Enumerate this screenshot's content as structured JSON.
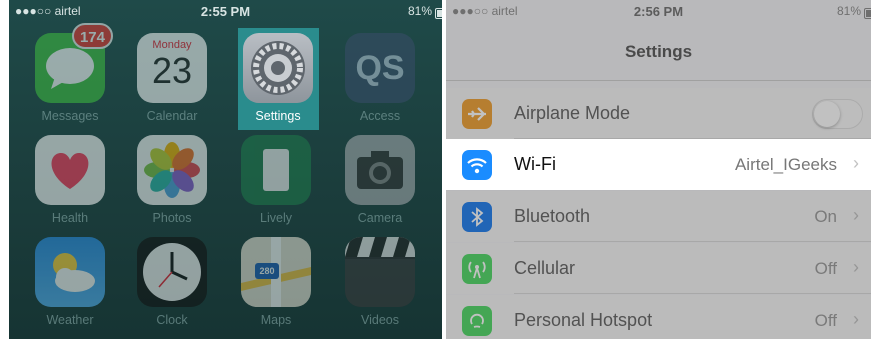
{
  "home": {
    "status": {
      "carrier": "●●●○○ airtel",
      "time": "2:55 PM",
      "battery": "81%"
    },
    "apps": [
      {
        "label": "Messages",
        "icon": "messages-icon",
        "badge": "174"
      },
      {
        "label": "Calendar",
        "icon": "calendar-icon",
        "day": "Monday",
        "date": "23"
      },
      {
        "label": "Settings",
        "icon": "settings-gear-icon"
      },
      {
        "label": "Access",
        "icon": "qs-access-icon",
        "text": "QS"
      },
      {
        "label": "Health",
        "icon": "health-heart-icon"
      },
      {
        "label": "Photos",
        "icon": "photos-flower-icon"
      },
      {
        "label": "Lively",
        "icon": "lively-icon"
      },
      {
        "label": "Camera",
        "icon": "camera-icon"
      },
      {
        "label": "Weather",
        "icon": "weather-icon"
      },
      {
        "label": "Clock",
        "icon": "clock-icon"
      },
      {
        "label": "Maps",
        "icon": "maps-icon",
        "shield": "280"
      },
      {
        "label": "Videos",
        "icon": "videos-clapper-icon"
      }
    ]
  },
  "settings": {
    "status": {
      "carrier": "●●●○○ airtel",
      "time": "2:56 PM",
      "battery": "81%"
    },
    "title": "Settings",
    "rows": [
      {
        "title": "Airplane Mode",
        "value": "",
        "toggle": "off",
        "color": "#f0a030",
        "icon": "airplane-icon"
      },
      {
        "title": "Wi-Fi",
        "value": "Airtel_IGeeks",
        "color": "#1a8cff",
        "icon": "wifi-icon"
      },
      {
        "title": "Bluetooth",
        "value": "On",
        "color": "#1a7bf0",
        "icon": "bluetooth-icon"
      },
      {
        "title": "Cellular",
        "value": "Off",
        "color": "#4cd964",
        "icon": "cellular-icon"
      },
      {
        "title": "Personal Hotspot",
        "value": "Off",
        "color": "#4cd964",
        "icon": "hotspot-icon"
      }
    ]
  }
}
